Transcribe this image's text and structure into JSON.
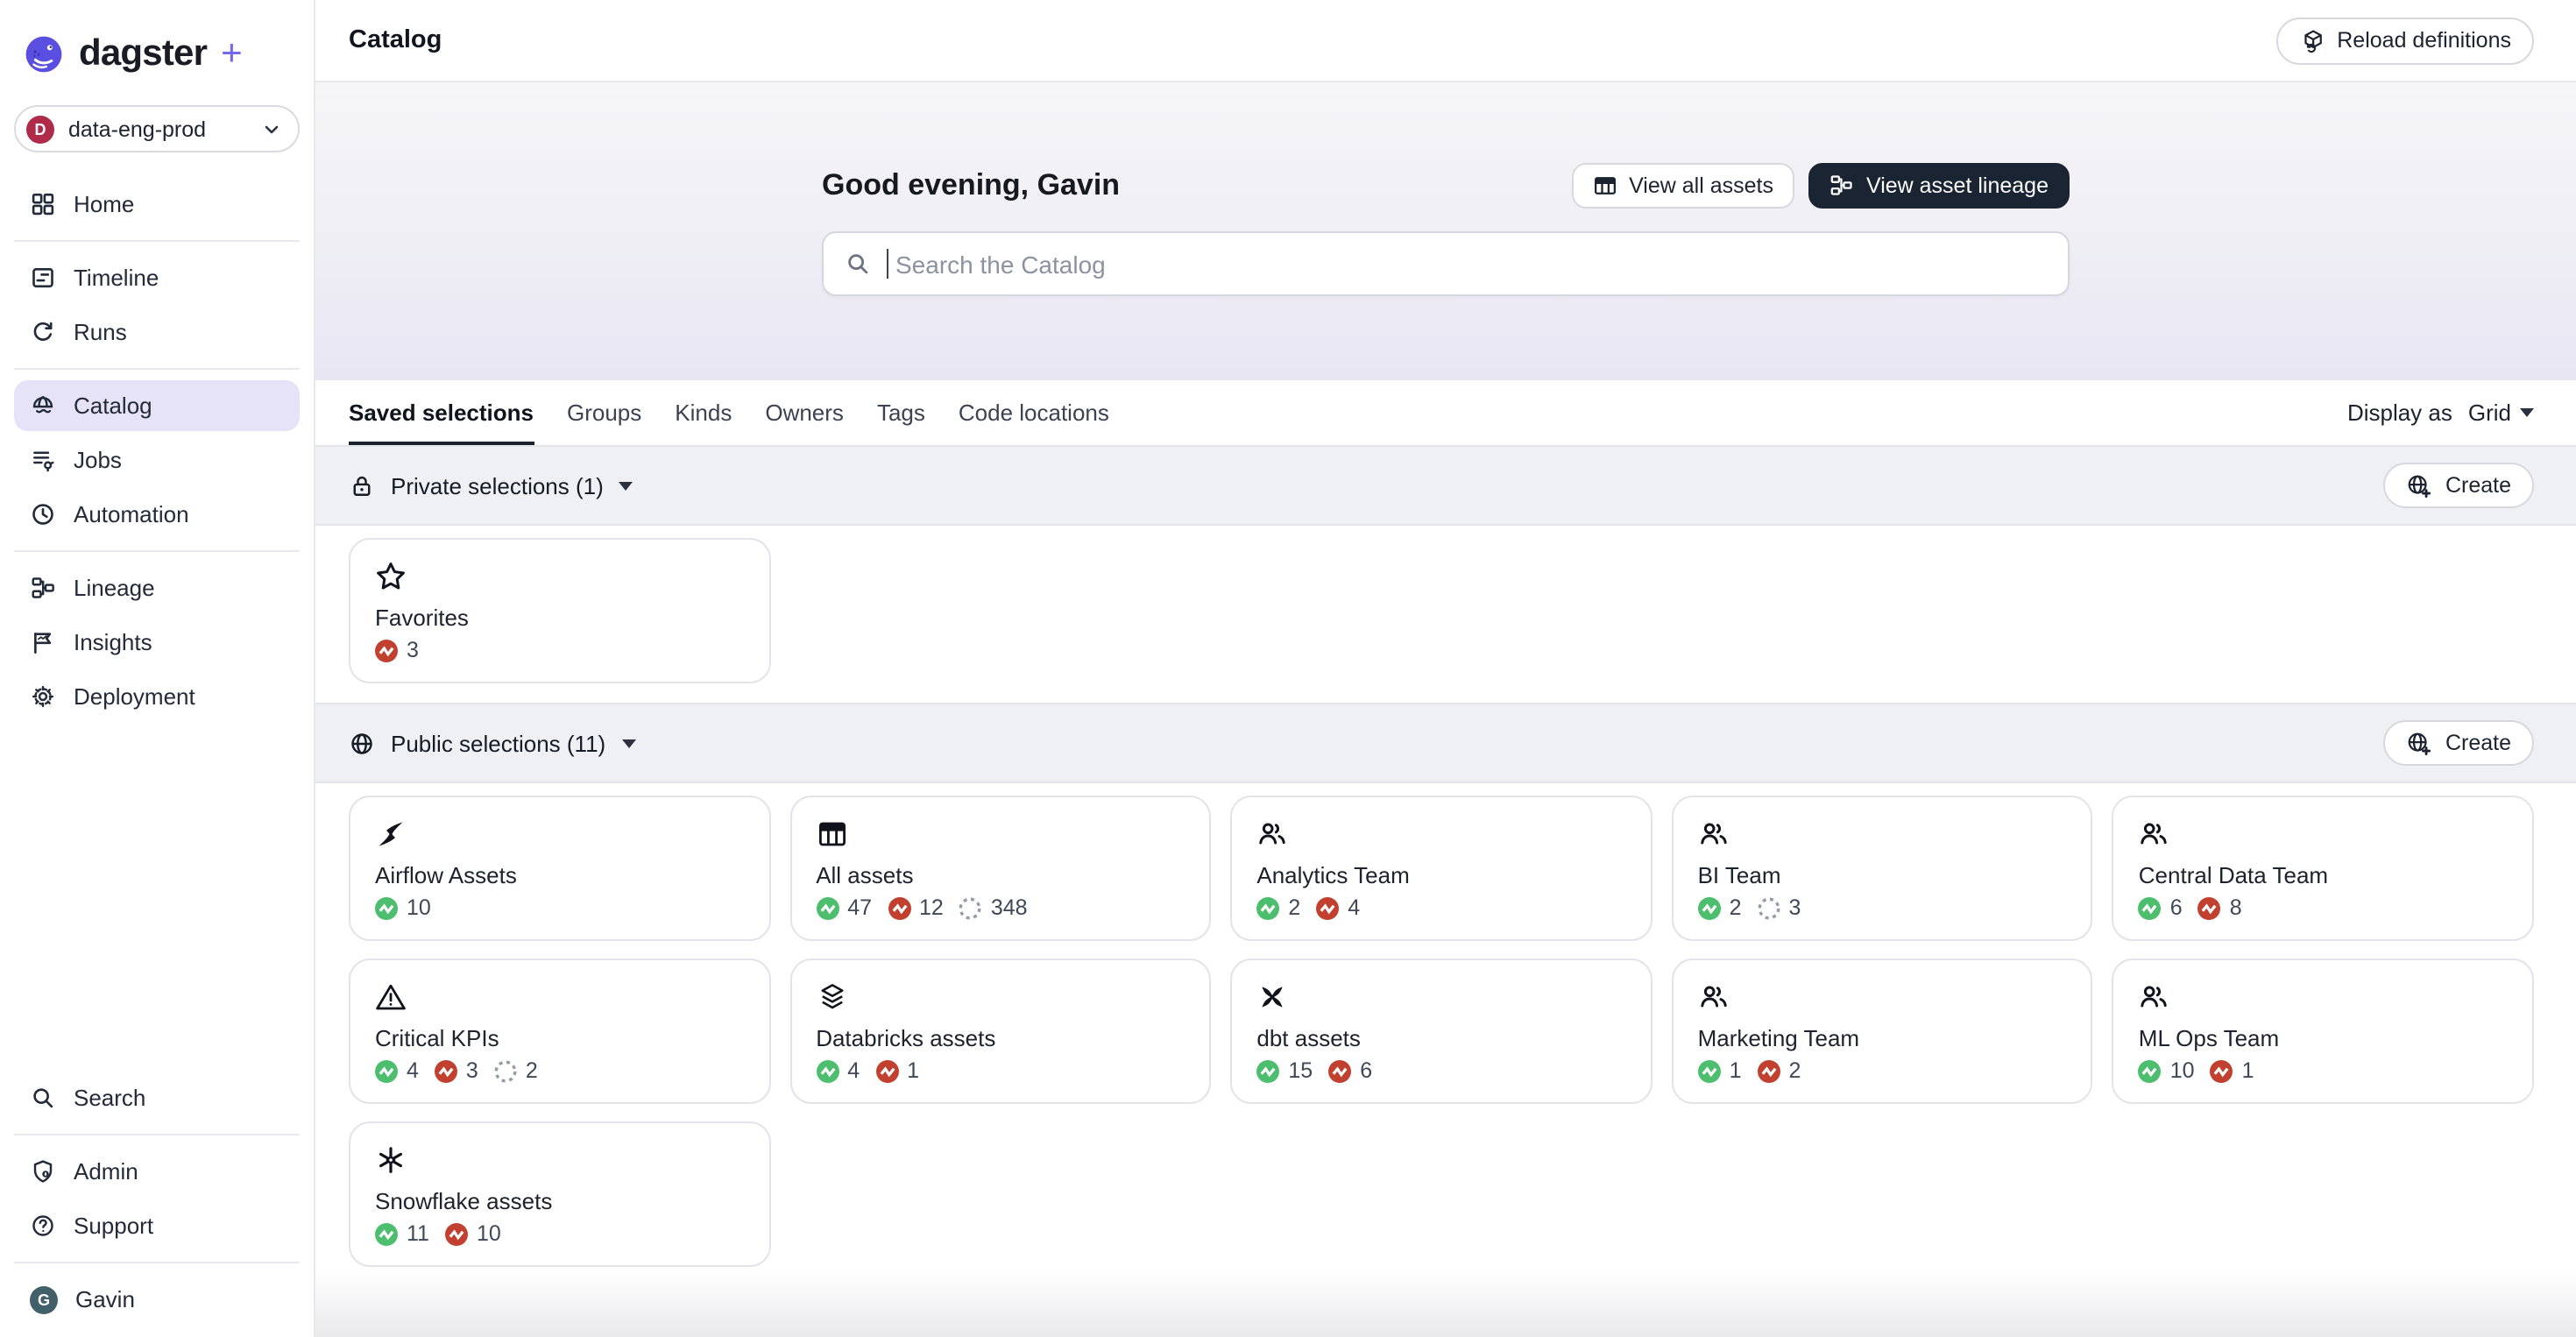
{
  "brand": {
    "name": "dagster",
    "plus": "+",
    "logo_icon": "dagster-octopus-icon"
  },
  "deployment": {
    "label": "data-eng-prod",
    "avatar_letter": "D",
    "avatar_color": "#b02b49"
  },
  "sidebar": {
    "groups": [
      {
        "items": [
          {
            "label": "Home",
            "icon": "grid-icon"
          }
        ]
      },
      {
        "items": [
          {
            "label": "Timeline",
            "icon": "timeline-icon"
          },
          {
            "label": "Runs",
            "icon": "runs-icon"
          }
        ]
      },
      {
        "items": [
          {
            "label": "Catalog",
            "icon": "catalog-icon",
            "active": true
          },
          {
            "label": "Jobs",
            "icon": "jobs-icon"
          },
          {
            "label": "Automation",
            "icon": "clock-icon"
          }
        ]
      },
      {
        "items": [
          {
            "label": "Lineage",
            "icon": "lineage-icon"
          },
          {
            "label": "Insights",
            "icon": "insights-icon"
          },
          {
            "label": "Deployment",
            "icon": "gear-icon"
          }
        ]
      }
    ],
    "bottom": {
      "search_label": "Search",
      "admin_label": "Admin",
      "support_label": "Support"
    },
    "user": {
      "name": "Gavin",
      "avatar_letter": "G",
      "avatar_color": "#41606a"
    }
  },
  "header": {
    "title": "Catalog",
    "reload_label": "Reload definitions",
    "reload_icon": "cube-reload-icon"
  },
  "hero": {
    "greeting": "Good evening, Gavin",
    "view_all_assets_label": "View all assets",
    "view_asset_lineage_label": "View asset lineage",
    "search_placeholder": "Search the Catalog"
  },
  "tabs": {
    "items": [
      "Saved selections",
      "Groups",
      "Kinds",
      "Owners",
      "Tags",
      "Code locations"
    ],
    "active": "Saved selections",
    "display_as_label": "Display as",
    "display_as_value": "Grid"
  },
  "sections": {
    "private": {
      "title": "Private selections (1)",
      "icon": "lock-icon",
      "create_label": "Create"
    },
    "public": {
      "title": "Public selections (11)",
      "icon": "globe-icon",
      "create_label": "Create"
    }
  },
  "private_cards": [
    {
      "title": "Favorites",
      "icon": "star-icon",
      "b1_type": "failed",
      "b1_count": "3",
      "b2_type": "",
      "b2_count": "",
      "b3_type": "",
      "b3_count": ""
    }
  ],
  "public_cards": [
    {
      "title": "Airflow Assets",
      "icon": "airflow-icon",
      "b1_type": "success",
      "b1_count": "10",
      "b2_type": "",
      "b2_count": "",
      "b3_type": "",
      "b3_count": ""
    },
    {
      "title": "All assets",
      "icon": "table-icon",
      "b1_type": "success",
      "b1_count": "47",
      "b2_type": "failed",
      "b2_count": "12",
      "b3_type": "never",
      "b3_count": "348"
    },
    {
      "title": "Analytics Team",
      "icon": "people-icon",
      "b1_type": "success",
      "b1_count": "2",
      "b2_type": "failed",
      "b2_count": "4",
      "b3_type": "",
      "b3_count": ""
    },
    {
      "title": "BI Team",
      "icon": "people-icon",
      "b1_type": "success",
      "b1_count": "2",
      "b2_type": "never",
      "b2_count": "3",
      "b3_type": "",
      "b3_count": ""
    },
    {
      "title": "Central Data Team",
      "icon": "people-icon",
      "b1_type": "success",
      "b1_count": "6",
      "b2_type": "failed",
      "b2_count": "8",
      "b3_type": "",
      "b3_count": ""
    },
    {
      "title": "Critical KPIs",
      "icon": "warning-icon",
      "b1_type": "success",
      "b1_count": "4",
      "b2_type": "failed",
      "b2_count": "3",
      "b3_type": "never",
      "b3_count": "2"
    },
    {
      "title": "Databricks assets",
      "icon": "layers-icon",
      "b1_type": "success",
      "b1_count": "4",
      "b2_type": "failed",
      "b2_count": "1",
      "b3_type": "",
      "b3_count": ""
    },
    {
      "title": "dbt assets",
      "icon": "dbt-icon",
      "b1_type": "success",
      "b1_count": "15",
      "b2_type": "failed",
      "b2_count": "6",
      "b3_type": "",
      "b3_count": ""
    },
    {
      "title": "Marketing Team",
      "icon": "people-icon",
      "b1_type": "success",
      "b1_count": "1",
      "b2_type": "failed",
      "b2_count": "2",
      "b3_type": "",
      "b3_count": ""
    },
    {
      "title": "ML Ops Team",
      "icon": "people-icon",
      "b1_type": "success",
      "b1_count": "10",
      "b2_type": "failed",
      "b2_count": "1",
      "b3_type": "",
      "b3_count": ""
    },
    {
      "title": "Snowflake assets",
      "icon": "snowflake-icon",
      "b1_type": "success",
      "b1_count": "11",
      "b2_type": "failed",
      "b2_count": "10",
      "b3_type": "",
      "b3_count": ""
    }
  ],
  "colors": {
    "accent_purple": "#6a5cff",
    "selected_nav_bg": "#e6e2f8",
    "success_green": "#4dbe6e",
    "failed_red": "#c2402f",
    "dark_button": "#1b2433",
    "hero_gradient_bottom": "#e8e6f3"
  }
}
